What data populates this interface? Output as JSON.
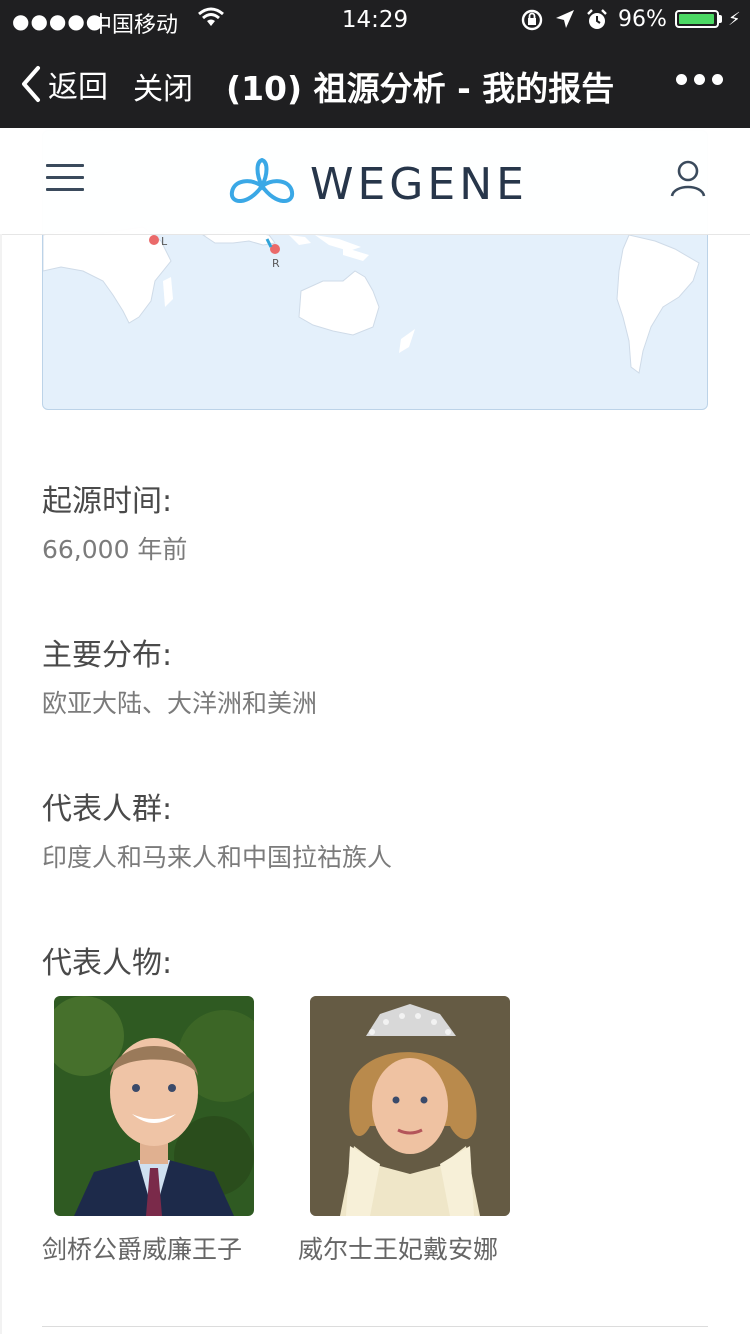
{
  "status_bar": {
    "signal": "●●●●●",
    "carrier": "中国移动",
    "time": "14:29",
    "battery_percent": "96%",
    "battery_level": 0.96
  },
  "nav": {
    "back_label": "返回",
    "close_label": "关闭",
    "title": "(10) 祖源分析 - 我的报告"
  },
  "header": {
    "logo_text": "WEGENE"
  },
  "map": {
    "markers": [
      "L",
      "R"
    ]
  },
  "details": {
    "origin_time_label": "起源时间:",
    "origin_time_value": "66,000 年前",
    "distribution_label": "主要分布:",
    "distribution_value": "欧亚大陆、大洋洲和美洲",
    "populations_label": "代表人群:",
    "populations_value": "印度人和马来人和中国拉祜族人",
    "figures_label": "代表人物:"
  },
  "figures": [
    {
      "name": "剑桥公爵威廉王子"
    },
    {
      "name": "威尔士王妃戴安娜"
    }
  ],
  "colors": {
    "nav_bg": "#1f1f21",
    "brand_blue": "#3aa8e6",
    "logo_text": "#27364a",
    "map_water": "#e4f0fb",
    "marker": "#ea6a6a"
  }
}
